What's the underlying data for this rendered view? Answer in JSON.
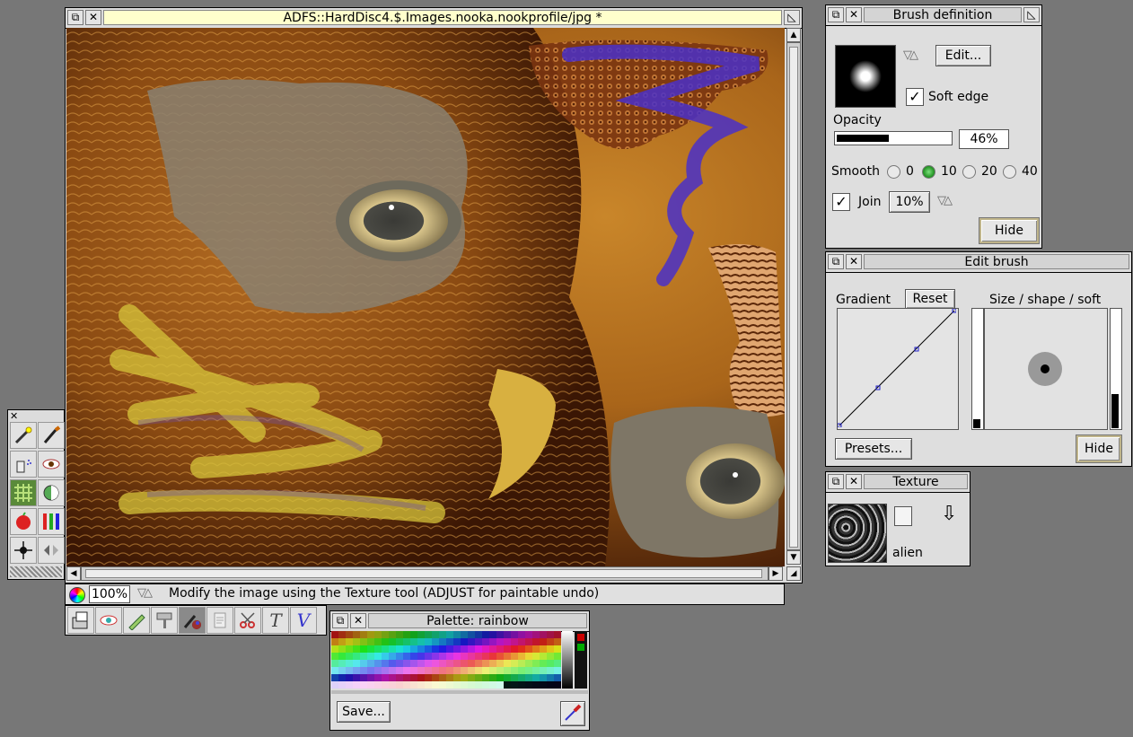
{
  "main_window": {
    "title": "ADFS::HardDisc4.$.Images.nooka.nookprofile/jpg *",
    "zoom": "100%",
    "status": "Modify the image using the Texture tool (ADJUST for paintable undo)"
  },
  "brush_definition": {
    "title": "Brush definition",
    "edit_label": "Edit...",
    "soft_edge_label": "Soft edge",
    "soft_edge_checked": true,
    "opacity_label": "Opacity",
    "opacity_value": "46%",
    "opacity_fraction": 0.46,
    "smooth_label": "Smooth",
    "smooth_options": [
      "0",
      "10",
      "20",
      "40"
    ],
    "smooth_selected": "10",
    "join_label": "Join",
    "join_checked": true,
    "join_value": "10%",
    "hide_label": "Hide"
  },
  "edit_brush": {
    "title": "Edit brush",
    "gradient_label": "Gradient",
    "reset_label": "Reset",
    "size_label": "Size / shape / soft",
    "presets_label": "Presets...",
    "hide_label": "Hide"
  },
  "texture": {
    "title": "Texture",
    "name": "alien"
  },
  "palette": {
    "title": "Palette: rainbow",
    "save_label": "Save..."
  },
  "toolbox": {
    "tools": [
      "magic-wand-icon",
      "brush-icon",
      "spray-icon",
      "eye-icon",
      "texture-icon",
      "shade-icon",
      "apple-icon",
      "color-bars-icon",
      "move-icon",
      "flip-icon"
    ],
    "selected": "texture-icon"
  },
  "bottom_toolbar": {
    "tools": [
      "open-file-icon",
      "eye-icon",
      "pencil-icon",
      "roller-icon",
      "paint-icon",
      "scroll-icon",
      "scissors-icon",
      "text-t-icon",
      "text-v-icon"
    ],
    "selected": "paint-icon"
  },
  "colors": {
    "title_yellow": "#ffffcc",
    "window_grey": "#dddddd",
    "desktop": "#777777"
  }
}
